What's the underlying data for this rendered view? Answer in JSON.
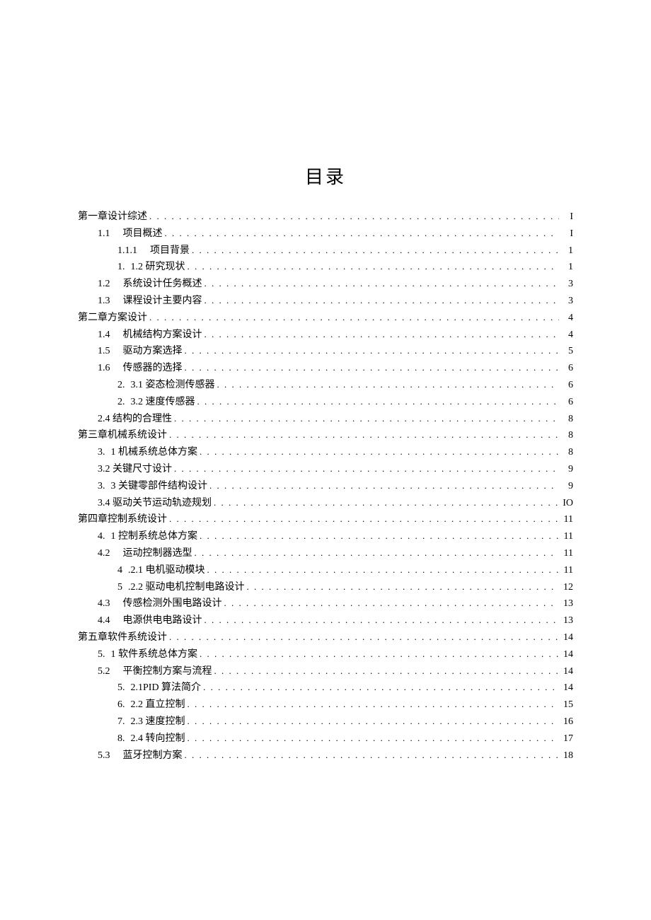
{
  "title": "目录",
  "entries": [
    {
      "level": 0,
      "num": "",
      "text": "第一章设计综述",
      "page": "I"
    },
    {
      "level": 1,
      "num": "1.1",
      "text": "项目概述",
      "page": "I",
      "numGap": true
    },
    {
      "level": 2,
      "num": "1.1.1",
      "text": "项目背景",
      "page": "1",
      "numGap": true
    },
    {
      "level": 2,
      "num": "1.",
      "text": "1.2 研究现状",
      "page": "1",
      "numGapSm": true
    },
    {
      "level": 1,
      "num": "1.2",
      "text": "系统设计任务概述",
      "page": "3",
      "numGap": true
    },
    {
      "level": 1,
      "num": "1.3",
      "text": "课程设计主要内容",
      "page": "3",
      "numGap": true
    },
    {
      "level": 0,
      "num": "",
      "text": "第二章方案设计",
      "page": "4"
    },
    {
      "level": 1,
      "num": "1.4",
      "text": "机械结构方案设计",
      "page": "4",
      "numGap": true
    },
    {
      "level": 1,
      "num": "1.5",
      "text": "驱动方案选择",
      "page": "5",
      "numGap": true
    },
    {
      "level": 1,
      "num": "1.6",
      "text": "传感器的选择",
      "page": "6",
      "numGap": true
    },
    {
      "level": 2,
      "num": "2.",
      "text": "3.1 姿态检测传感器",
      "page": "6",
      "numGapSm": true
    },
    {
      "level": 2,
      "num": "2.",
      "text": "3.2 速度传感器",
      "page": "6",
      "numGapSm": true
    },
    {
      "level": 1,
      "num": "",
      "text": "2.4 结构的合理性",
      "page": "8"
    },
    {
      "level": 0,
      "num": "",
      "text": "第三章机械系统设计",
      "page": "8"
    },
    {
      "level": 1,
      "num": "3.",
      "text": "1 机械系统总体方案",
      "page": "8",
      "numGapSm": true
    },
    {
      "level": 1,
      "num": "",
      "text": "3.2 关键尺寸设计",
      "page": "9"
    },
    {
      "level": 1,
      "num": "3.",
      "text": "3 关键零部件结构设计",
      "page": "9",
      "numGapSm": true
    },
    {
      "level": 1,
      "num": "",
      "text": "3.4 驱动关节运动轨迹规划",
      "page": "IO"
    },
    {
      "level": 0,
      "num": "",
      "text": "第四章控制系统设计",
      "page": "11"
    },
    {
      "level": 1,
      "num": "4.",
      "text": "1 控制系统总体方案",
      "page": "11",
      "numGapSm": true
    },
    {
      "level": 1,
      "num": "4.2",
      "text": "运动控制器选型",
      "page": "11",
      "numGap": true
    },
    {
      "level": 2,
      "num": "4",
      "text": ".2.1 电机驱动模块",
      "page": "11",
      "numGapSm": true
    },
    {
      "level": 2,
      "num": "5",
      "text": ".2.2 驱动电机控制电路设计",
      "page": "12",
      "numGapSm": true
    },
    {
      "level": 1,
      "num": "4.3",
      "text": "传感检测外围电路设计",
      "page": "13",
      "numGap": true
    },
    {
      "level": 1,
      "num": "4.4",
      "text": "电源供电电路设计",
      "page": "13",
      "numGap": true
    },
    {
      "level": 0,
      "num": "",
      "text": "第五章软件系统设计",
      "page": "14"
    },
    {
      "level": 1,
      "num": "5.",
      "text": "1 软件系统总体方案",
      "page": "14",
      "numGapSm": true
    },
    {
      "level": 1,
      "num": "5.2",
      "text": "平衡控制方案与流程",
      "page": "14",
      "numGap": true
    },
    {
      "level": 2,
      "num": "5.",
      "text": "2.1PID 算法简介",
      "page": "14",
      "numGapSm": true
    },
    {
      "level": 2,
      "num": "6.",
      "text": "2.2 直立控制",
      "page": "15",
      "numGapSm": true
    },
    {
      "level": 2,
      "num": "7.",
      "text": "2.3 速度控制",
      "page": "16",
      "numGapSm": true
    },
    {
      "level": 2,
      "num": "8.",
      "text": "2.4 转向控制",
      "page": "17",
      "numGapSm": true
    },
    {
      "level": 1,
      "num": "5.3",
      "text": "蓝牙控制方案",
      "page": "18",
      "numGap": true
    }
  ]
}
